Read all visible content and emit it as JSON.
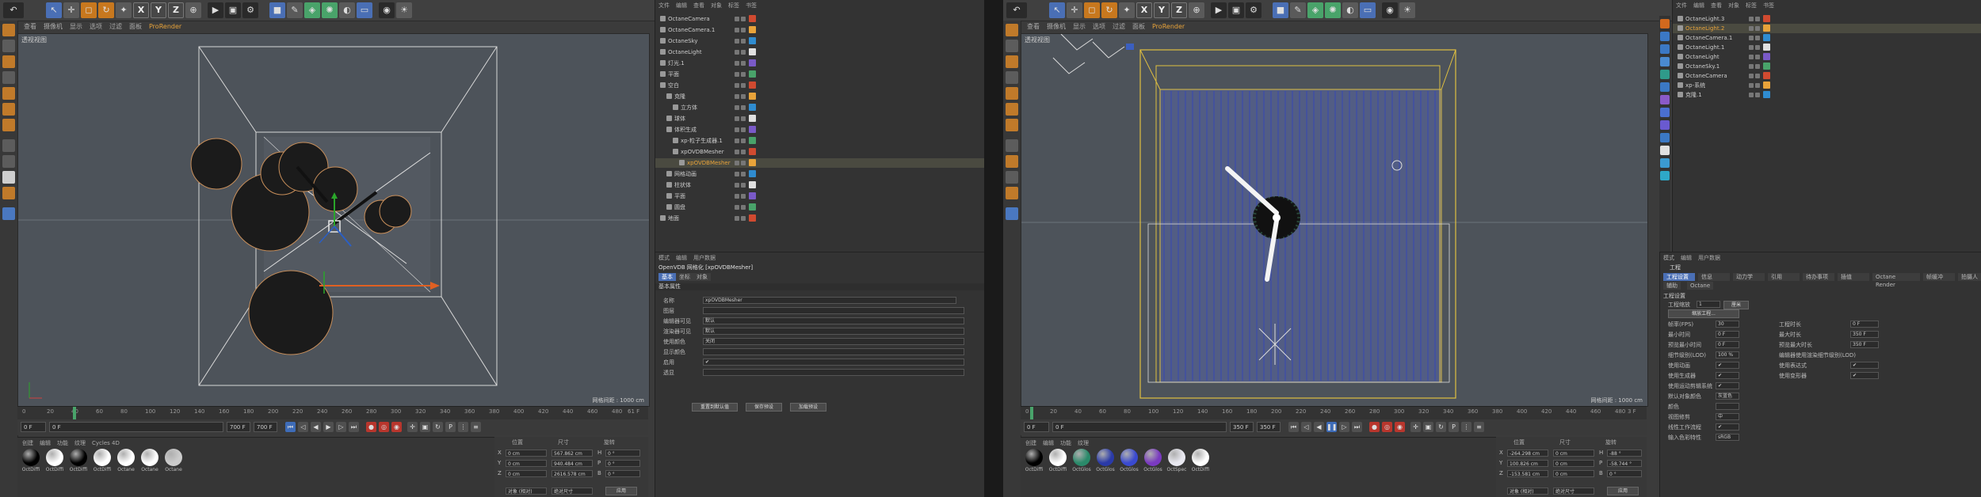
{
  "menu": [
    "查看",
    "摄像机",
    "显示",
    "选项",
    "过滤",
    "面板",
    "ProRender"
  ],
  "left": {
    "viewport": {
      "label": "透视视图",
      "grid": "网格间距 : 1000 cm"
    },
    "timeline": {
      "ticks": [
        "0",
        "20",
        "40",
        "60",
        "80",
        "100",
        "120",
        "140",
        "160",
        "180",
        "200",
        "220",
        "240",
        "260",
        "280",
        "300",
        "320",
        "340",
        "360",
        "380",
        "400",
        "420",
        "440",
        "460",
        "480"
      ],
      "current": "61 F"
    },
    "transport": {
      "start": "0 F",
      "cur": "0 F",
      "end": "700 F",
      "end2": "700 F"
    },
    "materials": {
      "menu": [
        "创建",
        "编辑",
        "功能",
        "纹理",
        "Cycles 4D"
      ],
      "items": [
        {
          "label": "OctDiffi",
          "color": "#000000"
        },
        {
          "label": "OctDiffi",
          "color": "#ffffff"
        },
        {
          "label": "OctDiffi",
          "color": "#000000"
        },
        {
          "label": "OctDiffi",
          "color": "#ffffff"
        },
        {
          "label": "Octane",
          "color": "#ffffff"
        },
        {
          "label": "Octane",
          "color": "#ffffff"
        },
        {
          "label": "Octane",
          "color": "#cccccc"
        }
      ]
    },
    "coords": {
      "headers": [
        "位置",
        "尺寸",
        "旋转"
      ],
      "rows": [
        {
          "axis": "X",
          "pos": "0 cm",
          "size": "567.862 cm",
          "rotl": "H",
          "rot": "0 °"
        },
        {
          "axis": "Y",
          "pos": "0 cm",
          "size": "940.484 cm",
          "rotl": "P",
          "rot": "0 °"
        },
        {
          "axis": "Z",
          "pos": "0 cm",
          "size": "2616.578 cm",
          "rotl": "B",
          "rot": "0 °"
        }
      ],
      "mode": "对象 (相对)",
      "size_mode": "绝对尺寸",
      "apply": "应用"
    },
    "objects": {
      "menu": [
        "文件",
        "编辑",
        "查看",
        "对象",
        "标签",
        "书签"
      ],
      "items": [
        {
          "name": "OctaneCamera",
          "depth": 0
        },
        {
          "name": "OctaneCamera.1",
          "depth": 0
        },
        {
          "name": "OctaneSky",
          "depth": 0
        },
        {
          "name": "OctaneLight",
          "depth": 0
        },
        {
          "name": "灯光.1",
          "depth": 0
        },
        {
          "name": "平面",
          "depth": 0
        },
        {
          "name": "空白",
          "depth": 0
        },
        {
          "name": "克隆",
          "depth": 1
        },
        {
          "name": "立方体",
          "depth": 2
        },
        {
          "name": "球体",
          "depth": 1
        },
        {
          "name": "体积生成",
          "depth": 1
        },
        {
          "name": "xp-粒子生成器.1",
          "depth": 2
        },
        {
          "name": "xpOVDBMesher",
          "depth": 2
        },
        {
          "name": "xpOVDBMesher",
          "depth": 3
        },
        {
          "name": "网格动画",
          "depth": 1
        },
        {
          "name": "柱状体",
          "depth": 1
        },
        {
          "name": "平面",
          "depth": 1
        },
        {
          "name": "圆盘",
          "depth": 1
        },
        {
          "name": "地面",
          "depth": 0
        }
      ]
    },
    "attributes": {
      "menu": [
        "模式",
        "编辑",
        "用户数据"
      ],
      "title": "OpenVDB 网格化 [xpOVDBMesher]",
      "tabs": [
        "基本",
        "坐标",
        "对象"
      ],
      "section": "基本属性",
      "rows": [
        {
          "label": "名称",
          "value": "xpOVDBMesher"
        },
        {
          "label": "图层",
          "value": ""
        },
        {
          "label": "编辑器可见",
          "value": "默认"
        },
        {
          "label": "渲染器可见",
          "value": "默认"
        },
        {
          "label": "使用颜色",
          "value": "关闭"
        },
        {
          "label": "显示颜色",
          "value": ""
        },
        {
          "label": "启用",
          "value": "✔"
        },
        {
          "label": "透显",
          "value": ""
        }
      ],
      "buttons": [
        "重置到默认值",
        "保存预设",
        "加载预设"
      ]
    }
  },
  "right": {
    "viewport": {
      "label": "透视视图",
      "grid": "网格间距 : 1000 cm"
    },
    "timeline": {
      "ticks": [
        "0",
        "20",
        "40",
        "60",
        "80",
        "100",
        "120",
        "140",
        "160",
        "180",
        "200",
        "220",
        "240",
        "260",
        "280",
        "300",
        "320",
        "340",
        "360",
        "380",
        "400",
        "420",
        "440",
        "460",
        "480"
      ],
      "current": "3 F"
    },
    "transport": {
      "start": "0 F",
      "cur": "0 F",
      "end": "350 F",
      "end2": "350 F"
    },
    "materials": {
      "menu": [
        "创建",
        "编辑",
        "功能",
        "纹理"
      ],
      "items": [
        {
          "label": "OctDiffi",
          "color": "#000000"
        },
        {
          "label": "OctDiffi",
          "color": "#ffffff"
        },
        {
          "label": "OctGlos",
          "color": "#2a8a6a"
        },
        {
          "label": "OctGlos",
          "color": "#2a3aa8"
        },
        {
          "label": "OctGlos",
          "color": "#3a4ad0"
        },
        {
          "label": "OctGlos",
          "color": "#7a3ac0"
        },
        {
          "label": "OctSpec",
          "color": "#e8e8f0"
        },
        {
          "label": "OctDiffi",
          "color": "#ffffff"
        }
      ]
    },
    "coords": {
      "headers": [
        "位置",
        "尺寸",
        "旋转"
      ],
      "rows": [
        {
          "axis": "X",
          "pos": "-264.298 cm",
          "size": "0 cm",
          "rotl": "H",
          "rot": "-88 °"
        },
        {
          "axis": "Y",
          "pos": "100.826 cm",
          "size": "0 cm",
          "rotl": "P",
          "rot": "-58.744 °"
        },
        {
          "axis": "Z",
          "pos": "-153.581 cm",
          "size": "0 cm",
          "rotl": "B",
          "rot": "0 °"
        }
      ],
      "mode": "对象 (相对)",
      "size_mode": "绝对尺寸",
      "apply": "应用"
    },
    "objects": {
      "menu": [
        "文件",
        "编辑",
        "查看",
        "对象",
        "标签",
        "书签"
      ],
      "items": [
        {
          "name": "OctaneLight.3",
          "depth": 0
        },
        {
          "name": "OctaneLight.2",
          "depth": 0
        },
        {
          "name": "OctaneCamera.1",
          "depth": 0
        },
        {
          "name": "OctaneLight.1",
          "depth": 0
        },
        {
          "name": "OctaneLight",
          "depth": 0
        },
        {
          "name": "OctaneSky.1",
          "depth": 0
        },
        {
          "name": "OctaneCamera",
          "depth": 0
        },
        {
          "name": "xp-系统",
          "depth": 0
        },
        {
          "name": "克隆.1",
          "depth": 0
        }
      ]
    },
    "attributes": {
      "menu": [
        "模式",
        "编辑",
        "用户数据"
      ],
      "title": "工程",
      "tabs": [
        "工程设置",
        "信息",
        "动力学",
        "引用",
        "待办事项",
        "插值",
        "Octane Render",
        "帧缓冲",
        "拍摄人"
      ],
      "tabs2": [
        "辅助",
        "Octane"
      ],
      "section": "工程设置",
      "rows_left": [
        {
          "label": "工程缩放",
          "value": "1"
        },
        {
          "label": "帧率(FPS)",
          "value": "30"
        },
        {
          "label": "最小时间",
          "value": "0 F"
        },
        {
          "label": "预览最小时间",
          "value": "0 F"
        },
        {
          "label": "细节级别(LOD)",
          "value": "100 %"
        },
        {
          "label": "使用动画",
          "value": "✔"
        },
        {
          "label": "使用生成器",
          "value": "✔"
        },
        {
          "label": "使用运动剪辑系统",
          "value": "✔"
        },
        {
          "label": "默认对象颜色",
          "value": "灰蓝色"
        },
        {
          "label": "颜色",
          "value": ""
        },
        {
          "label": "视图修剪",
          "value": "中"
        },
        {
          "label": "线性工作流程",
          "value": "✔"
        },
        {
          "label": "输入色彩特性",
          "value": "sRGB"
        }
      ],
      "rows_right": [
        {
          "label": "工程时长",
          "value": "0 F"
        },
        {
          "label": "最大时长",
          "value": "350 F"
        },
        {
          "label": "预览最大时长",
          "value": "350 F"
        },
        {
          "label": "编辑器使用渲染细节级别(LOD)",
          "value": ""
        },
        {
          "label": "使用表达式",
          "value": "✔"
        },
        {
          "label": "使用变形器",
          "value": "✔"
        }
      ],
      "scale_unit": "厘米",
      "scale_btn": "缩放工程..."
    }
  }
}
